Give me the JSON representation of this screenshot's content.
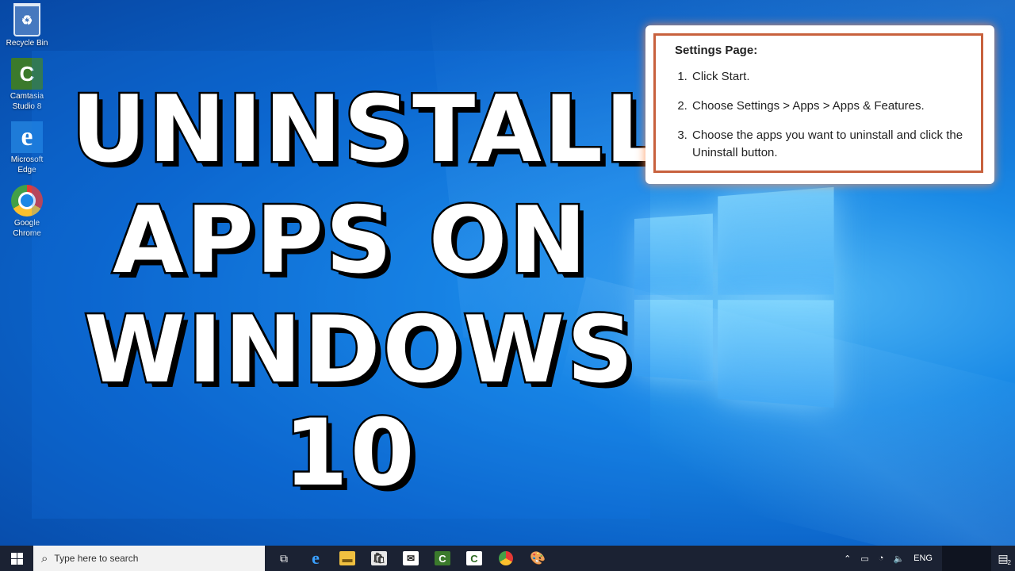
{
  "desktop": {
    "icons": [
      {
        "label": "Recycle Bin",
        "icon": "recycle-bin-icon"
      },
      {
        "label": "Camtasia\nStudio 8",
        "icon": "camtasia-icon"
      },
      {
        "label": "Microsoft\nEdge",
        "icon": "edge-icon"
      },
      {
        "label": "Google\nChrome",
        "icon": "chrome-icon"
      }
    ]
  },
  "headline": {
    "line1": "UNINSTALL",
    "line2": "APPS ON",
    "line3": "WINDOWS",
    "line4": "10"
  },
  "instructions": {
    "title": "Settings Page:",
    "steps": [
      "Click Start.",
      "Choose Settings > Apps > Apps & Features.",
      "Choose the apps you want to uninstall and click the Uninstall button."
    ]
  },
  "taskbar": {
    "search_placeholder": "Type here to search",
    "apps": [
      "task-view-icon",
      "edge-icon",
      "file-explorer-icon",
      "store-icon",
      "mail-icon",
      "camtasia-icon",
      "camtasia-recorder-icon",
      "chrome-icon",
      "paint-icon"
    ],
    "tray": {
      "language": "ENG",
      "notification_count": "2"
    }
  },
  "colors": {
    "accent_border": "#c8613d",
    "taskbar": "#1b2233",
    "desktop_blue": "#0b63c9"
  }
}
